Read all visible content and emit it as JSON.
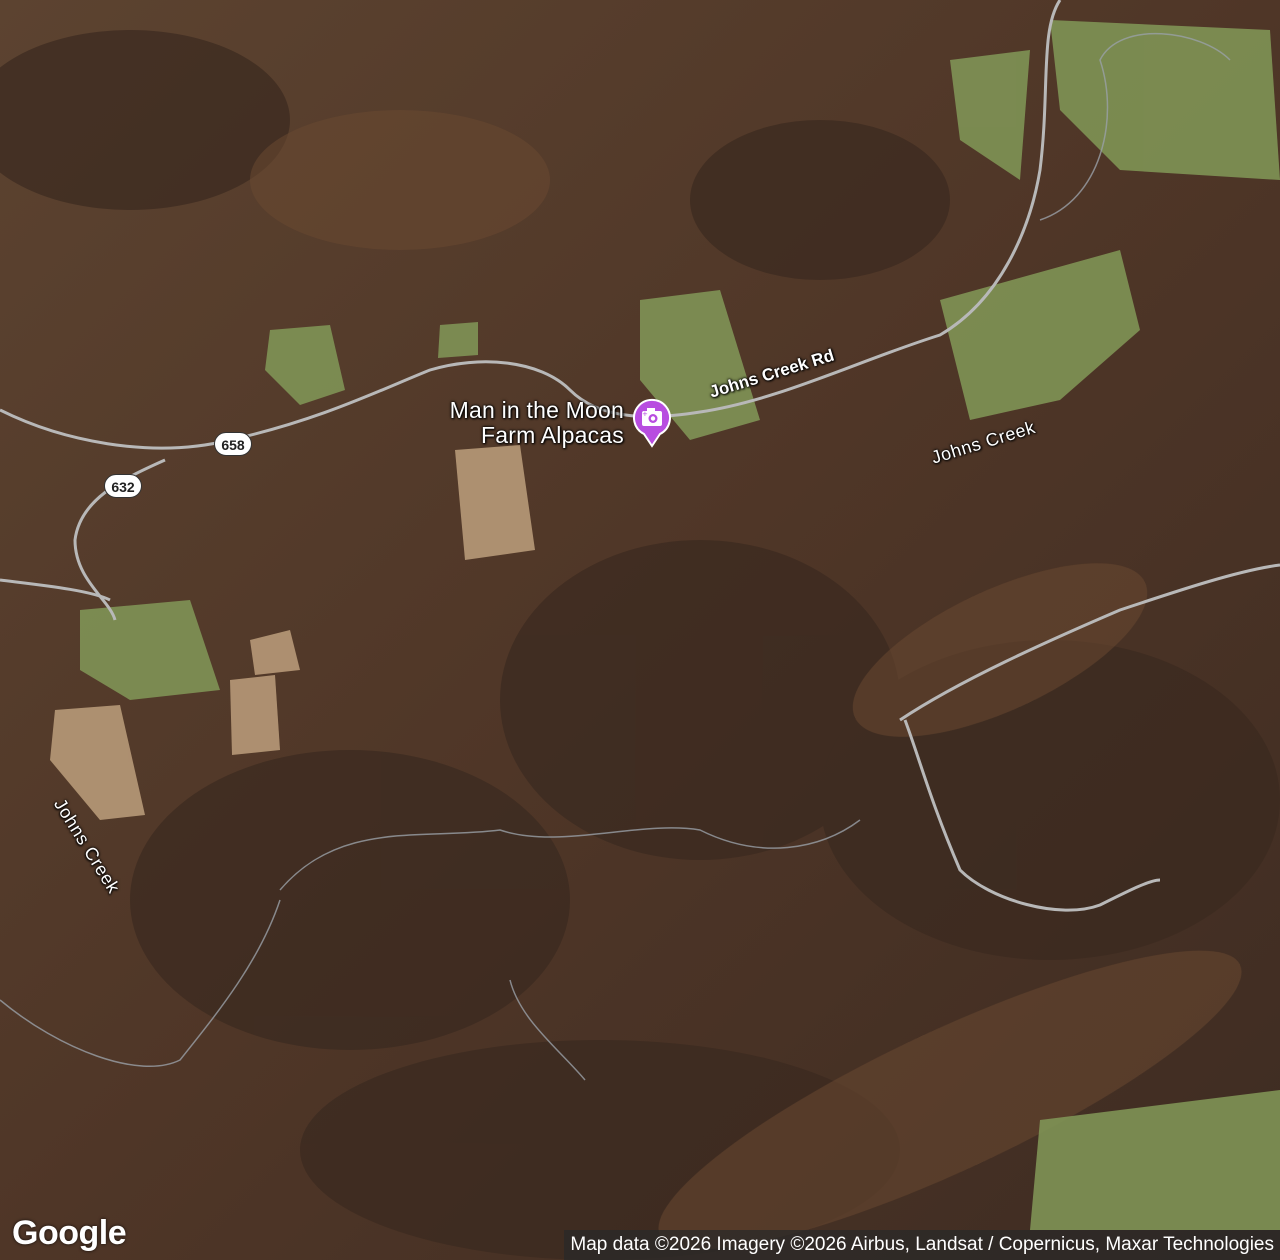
{
  "map": {
    "imagery": "satellite",
    "colors": {
      "terrain": "#5a3f2c",
      "field": "#8a9a5a",
      "road": "#b8b8b8",
      "pin": "#b84de0"
    }
  },
  "poi": {
    "name_line1": "Man in the Moon",
    "name_line2": "Farm Alpacas",
    "icon": "camera-icon"
  },
  "labels": {
    "road": "Johns Creek Rd",
    "creek_east": "Johns Creek",
    "creek_west": "Johns Creek"
  },
  "shields": {
    "route_658": "658",
    "route_632": "632"
  },
  "footer": {
    "logo": "Google",
    "attribution": "Map data ©2026 Imagery ©2026 Airbus, Landsat / Copernicus, Maxar Technologies"
  }
}
